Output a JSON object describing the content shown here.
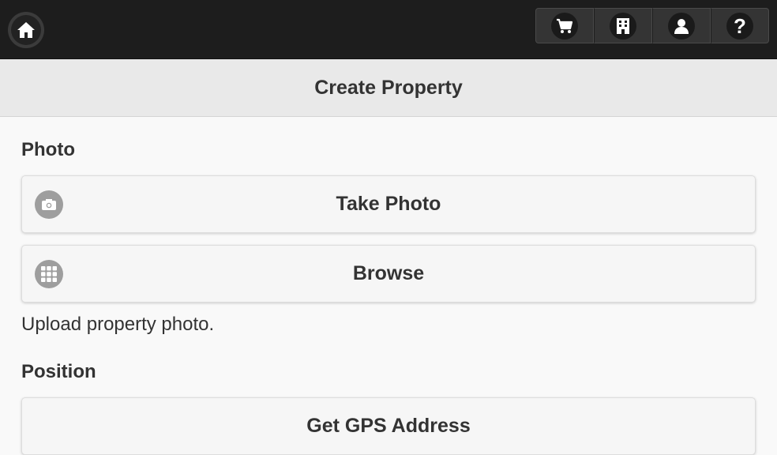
{
  "topbar": {
    "home_icon": "home-icon",
    "nav": [
      {
        "icon": "cart-icon"
      },
      {
        "icon": "building-icon"
      },
      {
        "icon": "user-icon"
      },
      {
        "icon": "help-icon",
        "glyph": "?"
      }
    ]
  },
  "header": {
    "title": "Create Property"
  },
  "photo": {
    "label": "Photo",
    "take_photo_label": "Take Photo",
    "take_photo_icon": "camera-icon",
    "browse_label": "Browse",
    "browse_icon": "grid-icon",
    "helper": "Upload property photo."
  },
  "position": {
    "label": "Position",
    "gps_label": "Get GPS Address"
  },
  "colors": {
    "topbar_bg": "#1d1d1d",
    "header_bg": "#e9e9e9",
    "page_bg": "#f9f9f9",
    "button_bg": "#f6f6f6",
    "icon_disc": "#9e9e9e",
    "text": "#333333"
  }
}
